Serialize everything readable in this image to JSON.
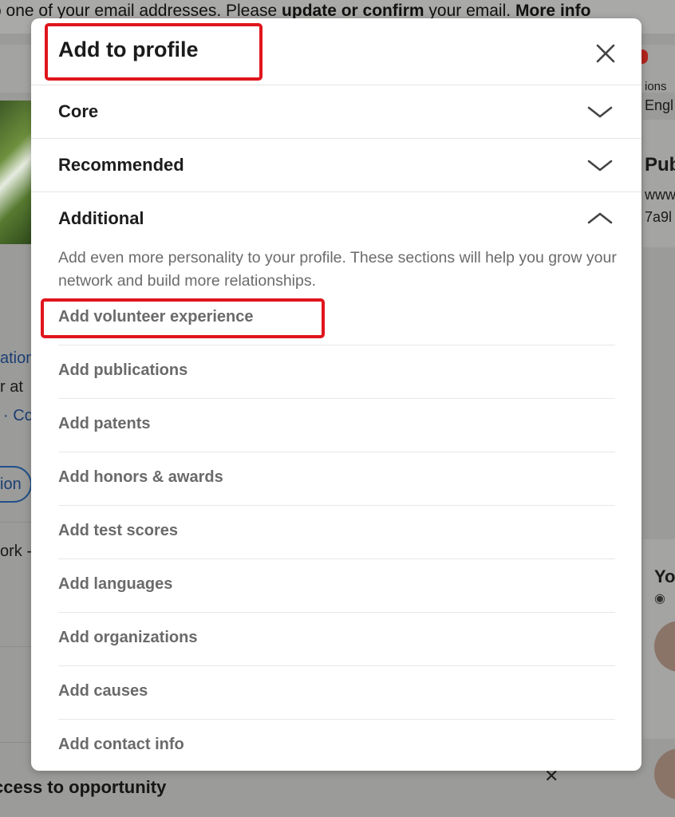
{
  "background": {
    "banner": {
      "lead": "o one of your email addresses. Please ",
      "update_link": "update or confirm",
      "middle": " your email. ",
      "more_info": "More info"
    },
    "fragments": {
      "ation": "ation",
      "r_at": "r at",
      "co": "· Co",
      "ion": "ion",
      "ork": "ork -",
      "ions": "ions",
      "engl": "Engl",
      "pub": "Pub",
      "www": "www",
      "code": "7a9l",
      "yo": "Yo"
    },
    "bottom_title": "ccess to opportunity",
    "close_glyph": "✕",
    "colors": {
      "overlay": "#9b9b99",
      "link_blue": "#1b3f73",
      "badge_red": "#b3261e"
    }
  },
  "modal": {
    "title": "Add to profile",
    "close_icon": "close-icon",
    "highlight_color": "#e0151c",
    "sections": [
      {
        "label": "Core",
        "expanded": false,
        "icon": "chevron-down-icon"
      },
      {
        "label": "Recommended",
        "expanded": false,
        "icon": "chevron-down-icon"
      },
      {
        "label": "Additional",
        "expanded": true,
        "icon": "chevron-up-icon"
      }
    ],
    "additional": {
      "description": "Add even more personality to your profile. These sections will help you grow your network and build more relationships.",
      "items": [
        "Add volunteer experience",
        "Add publications",
        "Add patents",
        "Add honors & awards",
        "Add test scores",
        "Add languages",
        "Add organizations",
        "Add causes",
        "Add contact info"
      ]
    }
  }
}
